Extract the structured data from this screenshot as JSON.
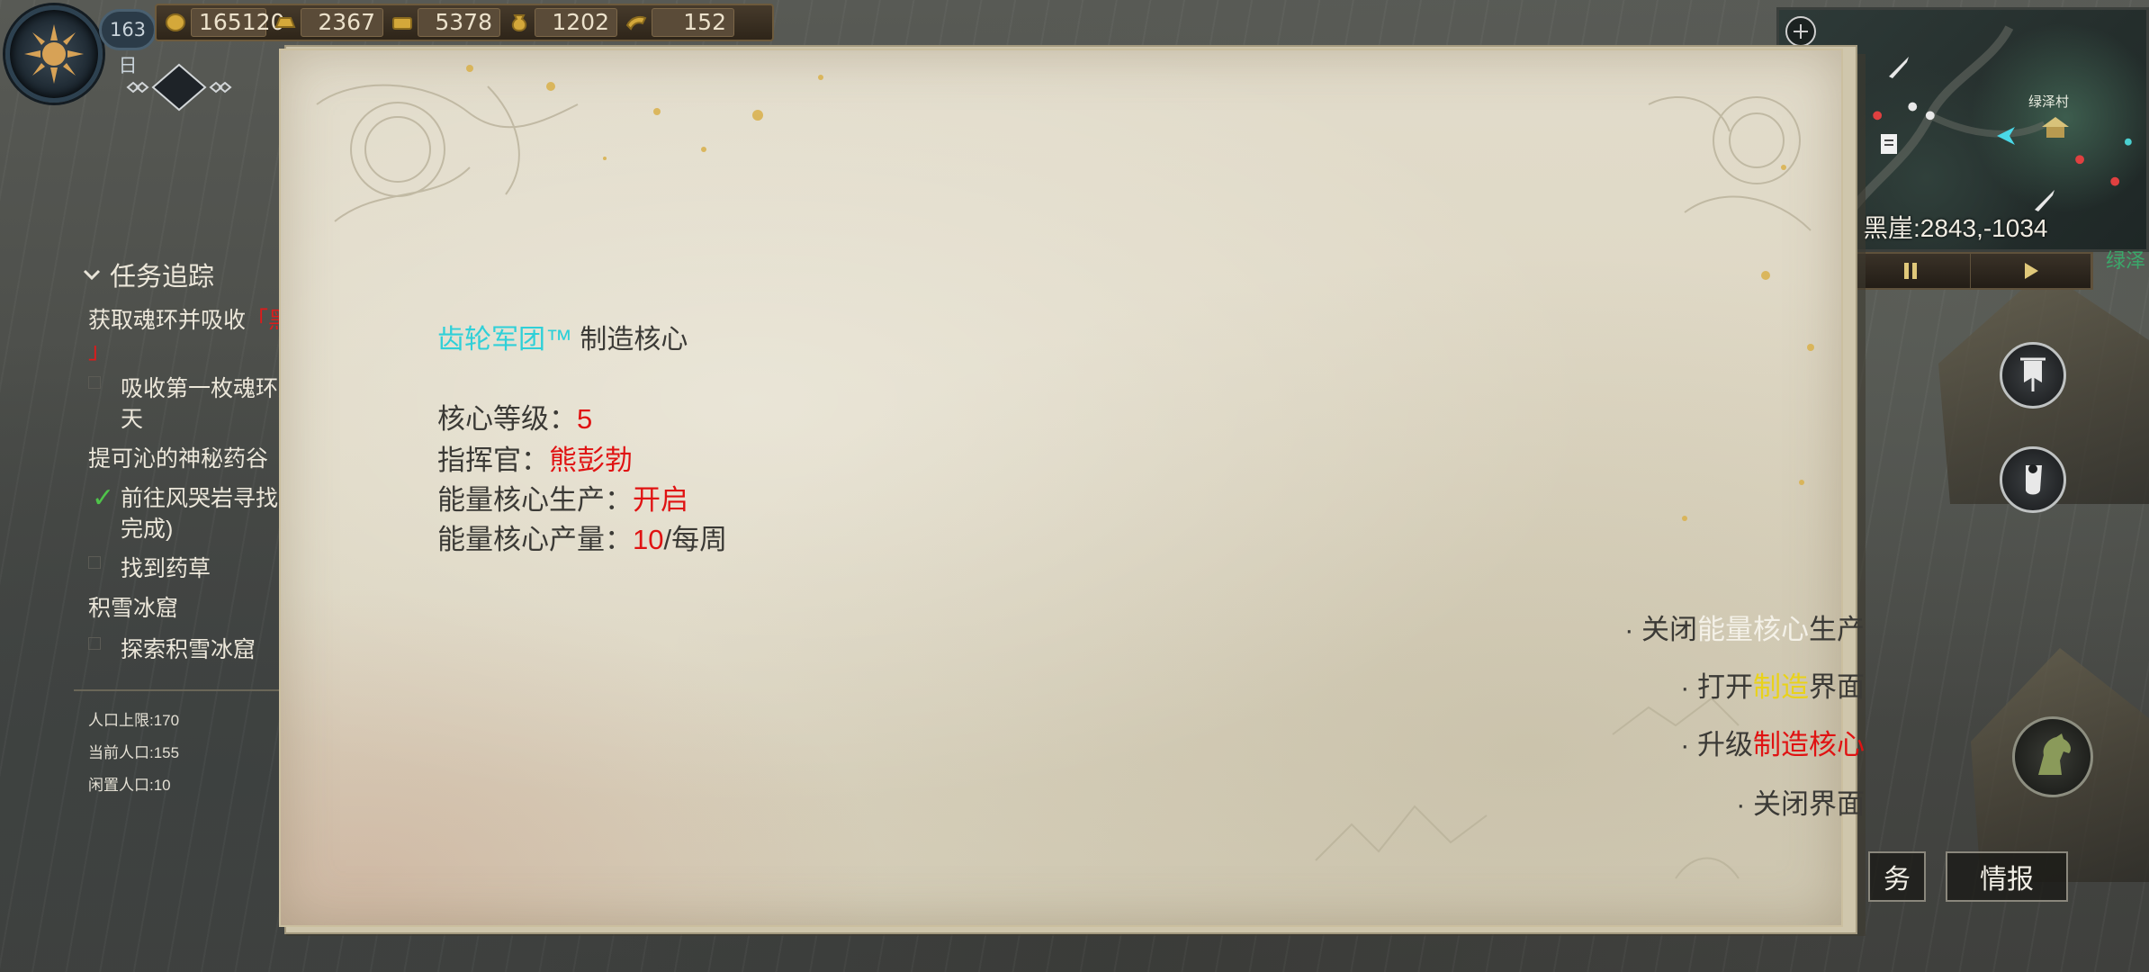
{
  "hud": {
    "day": "163日",
    "resources": [
      {
        "icon": "gold-coin-icon",
        "value": "165120"
      },
      {
        "icon": "gold-ingot-icon",
        "value": "2367"
      },
      {
        "icon": "gold-bar-icon",
        "value": "5378"
      },
      {
        "icon": "grain-sack-icon",
        "value": "1202"
      },
      {
        "icon": "horn-icon",
        "value": "152"
      }
    ]
  },
  "quests": {
    "header": "任务追踪",
    "lines": [
      {
        "text": "获取魂环并吸收",
        "suffix": "「黑"
      },
      {
        "text": "」"
      },
      {
        "text": "吸收第一枚魂环历"
      },
      {
        "text": "天"
      },
      {
        "text": "提可沁的神秘药谷"
      },
      {
        "text": "前往风哭岩寻找人"
      },
      {
        "text": "完成)"
      },
      {
        "text": "找到药草"
      },
      {
        "text": "积雪冰窟"
      },
      {
        "text": "探索积雪冰窟"
      }
    ],
    "population": {
      "cap": "人口上限:170",
      "current": "当前人口:155",
      "idle": "闲置人口:10"
    }
  },
  "minimap": {
    "coords": "黑崖:2843,-1034",
    "village": "绿泽村",
    "edge_label": "绿泽"
  },
  "buttons": {
    "task_partial": "务",
    "intel": "情报"
  },
  "dialog": {
    "faction": "齿轮军团™",
    "title": "制造核心",
    "rows": [
      {
        "label": "核心等级：",
        "value": "5",
        "suffix": ""
      },
      {
        "label": "指挥官：",
        "value": "熊彭勃",
        "suffix": ""
      },
      {
        "label": "能量核心生产：",
        "value": "开启",
        "suffix": ""
      },
      {
        "label": "能量核心产量：",
        "value": "10",
        "suffix": "/每周"
      }
    ],
    "actions": [
      {
        "prefix": "· 关闭",
        "highlight": "能量核心",
        "rest": "生产"
      },
      {
        "prefix": "· 打开",
        "highlight": "制造",
        "rest": "界面"
      },
      {
        "prefix": "· 升级",
        "highlight": "制造核心",
        "rest": ""
      },
      {
        "prefix": "· 关闭界面",
        "highlight": "",
        "rest": ""
      }
    ]
  },
  "colors": {
    "faction_cyan": "#2fd0d8",
    "value_red": "#e01212",
    "highlight_yellow": "#e9d21a",
    "check_green": "#4fc44a"
  }
}
